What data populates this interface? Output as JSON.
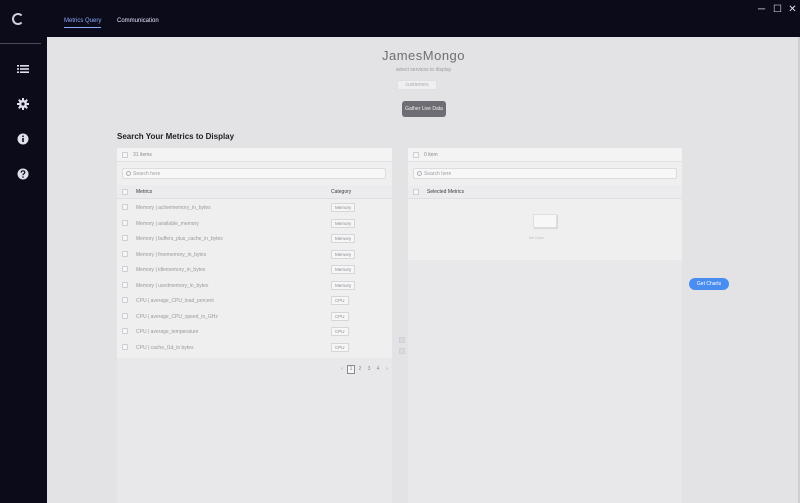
{
  "window": {
    "tabs": [
      {
        "label": "Metrics Query",
        "active": true
      },
      {
        "label": "Communication",
        "active": false
      }
    ],
    "controls": {
      "minimize": "─",
      "maximize": "☐",
      "close": "✕"
    }
  },
  "sidebar": {
    "icons": [
      "list-icon",
      "gear-icon",
      "info-icon",
      "help-icon"
    ]
  },
  "header": {
    "title": "JamesMongo",
    "subtitle": "select services to display",
    "service_value": "customers",
    "gather_button": "Gather Live Data"
  },
  "search_section": {
    "title": "Search Your Metrics to Display",
    "left": {
      "count": "31 items",
      "search_placeholder": "Search here",
      "col_metrics": "Metrics",
      "col_category": "Category",
      "rows": [
        {
          "name": "Memory | activememory_in_bytes",
          "category": "Memory"
        },
        {
          "name": "Memory | available_memory",
          "category": "Memory"
        },
        {
          "name": "Memory | buffers_plus_cache_in_bytes",
          "category": "Memory"
        },
        {
          "name": "Memory | freememory_in_bytes",
          "category": "Memory"
        },
        {
          "name": "Memory | idlememory_in_bytes",
          "category": "Memory"
        },
        {
          "name": "Memory | usedmemory_in_bytes",
          "category": "Memory"
        },
        {
          "name": "CPU | average_CPU_load_percent",
          "category": "CPU"
        },
        {
          "name": "CPU | average_CPU_speed_in_GHz",
          "category": "CPU"
        },
        {
          "name": "CPU | average_temperature",
          "category": "CPU"
        },
        {
          "name": "CPU | cache_l1d_in bytes",
          "category": "CPU"
        }
      ],
      "pagination": {
        "prev": "‹",
        "pages": [
          "1",
          "2",
          "3",
          "4"
        ],
        "next": "›",
        "current": "1"
      }
    },
    "right": {
      "count": "0 item",
      "search_placeholder": "Search here",
      "col_selected": "Selected Metrics",
      "empty_text": "No Data"
    },
    "get_charts_button": "Get Charts"
  },
  "colors": {
    "chrome_bg": "#0b0b1a",
    "main_bg": "#e3e3e5",
    "accent": "#4a8df0",
    "active_tab": "#8fa9ff",
    "gather_button": "#6d6d73"
  }
}
